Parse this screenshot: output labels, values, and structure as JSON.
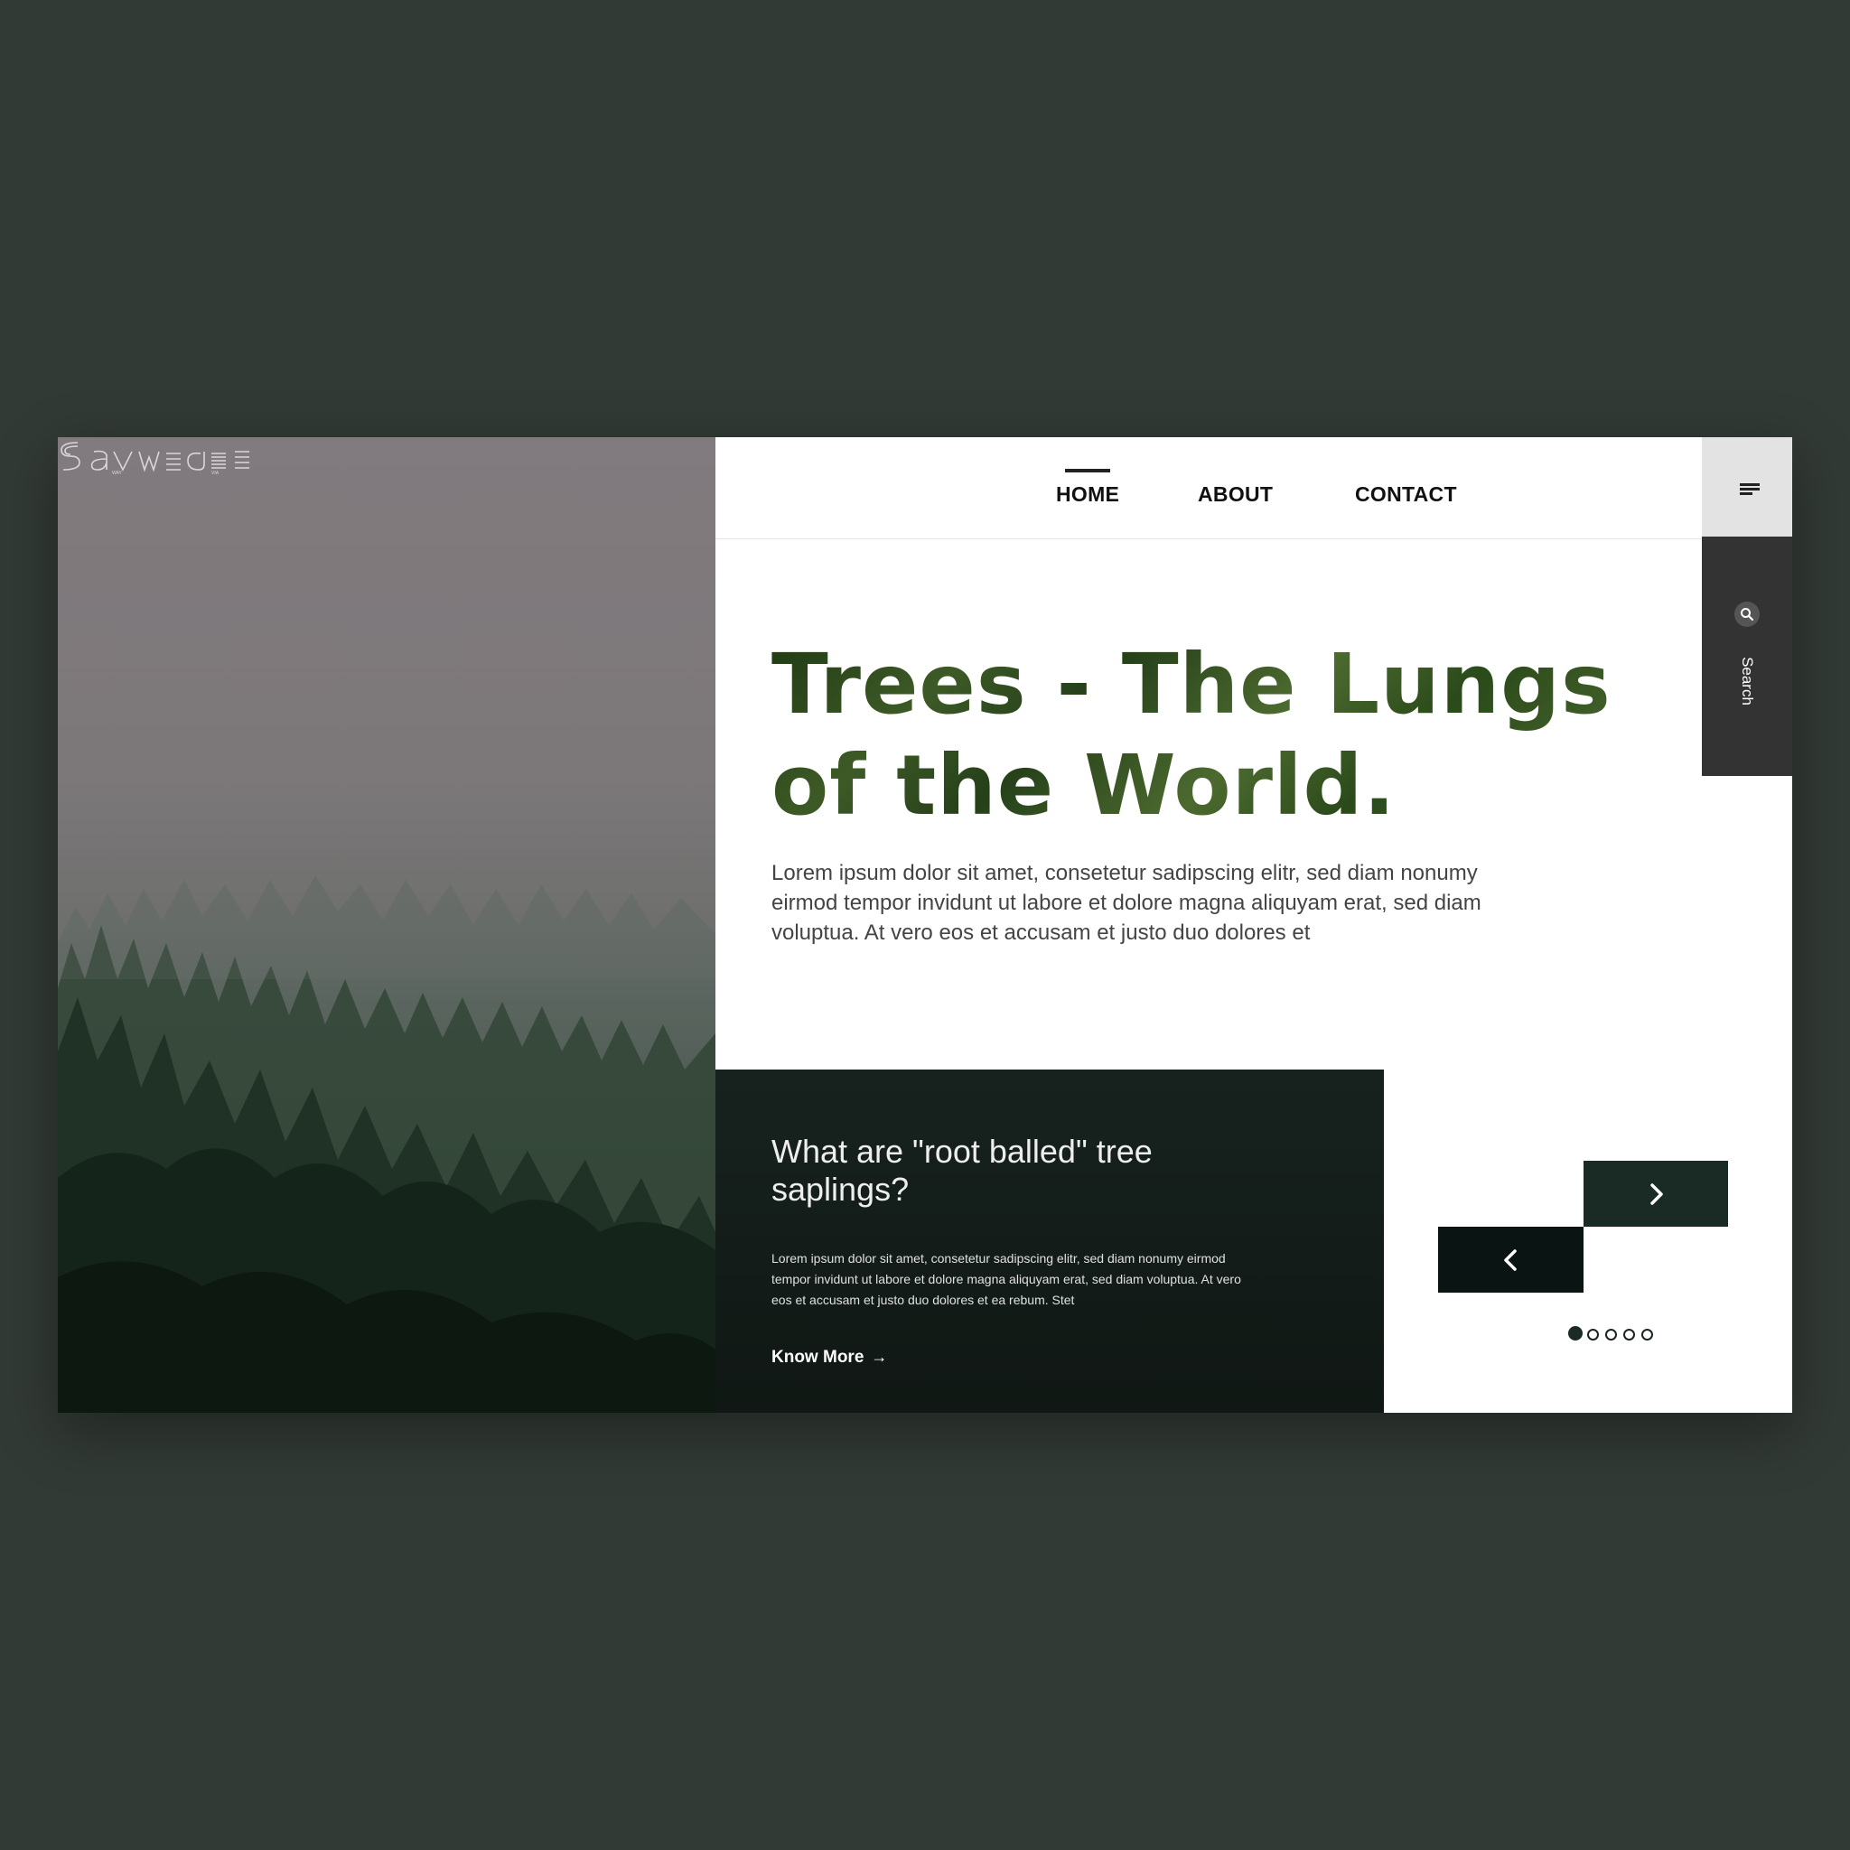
{
  "brand": {
    "logo_text": "Saveare"
  },
  "nav": {
    "items": [
      {
        "label": "HOME",
        "active": true
      },
      {
        "label": "ABOUT",
        "active": false
      },
      {
        "label": "CONTACT",
        "active": false
      }
    ]
  },
  "sidebar": {
    "menu_icon": "hamburger-menu-icon",
    "search_icon": "search-icon",
    "search_label": "Search"
  },
  "hero": {
    "title_line1": "Trees - The Lungs",
    "title_line2": "of the World.",
    "intro": "Lorem ipsum dolor sit amet, consetetur sadipscing elitr, sed diam nonumy eirmod tempor invidunt ut labore et dolore magna aliquyam erat, sed diam voluptua. At vero eos et accusam et justo duo dolores et"
  },
  "card": {
    "title": "What are \"root balled\" tree saplings?",
    "text": "Lorem ipsum dolor sit amet, consetetur sadipscing elitr, sed diam nonumy eirmod tempor invidunt ut labore et dolore magna aliquyam erat, sed diam voluptua. At vero eos et accusam et justo duo dolores et ea rebum. Stet",
    "link_label": "Know More",
    "link_arrow": "→"
  },
  "slider": {
    "prev_icon": "chevron-left-icon",
    "next_icon": "chevron-right-icon",
    "total_slides": 5,
    "active_slide": 1
  },
  "colors": {
    "page_background": "#323a35",
    "card_background": "#131c18",
    "next_button": "#1a2a24",
    "prev_button": "#0a1412",
    "search_panel": "#333333",
    "menu_panel": "#e3e3e3"
  }
}
